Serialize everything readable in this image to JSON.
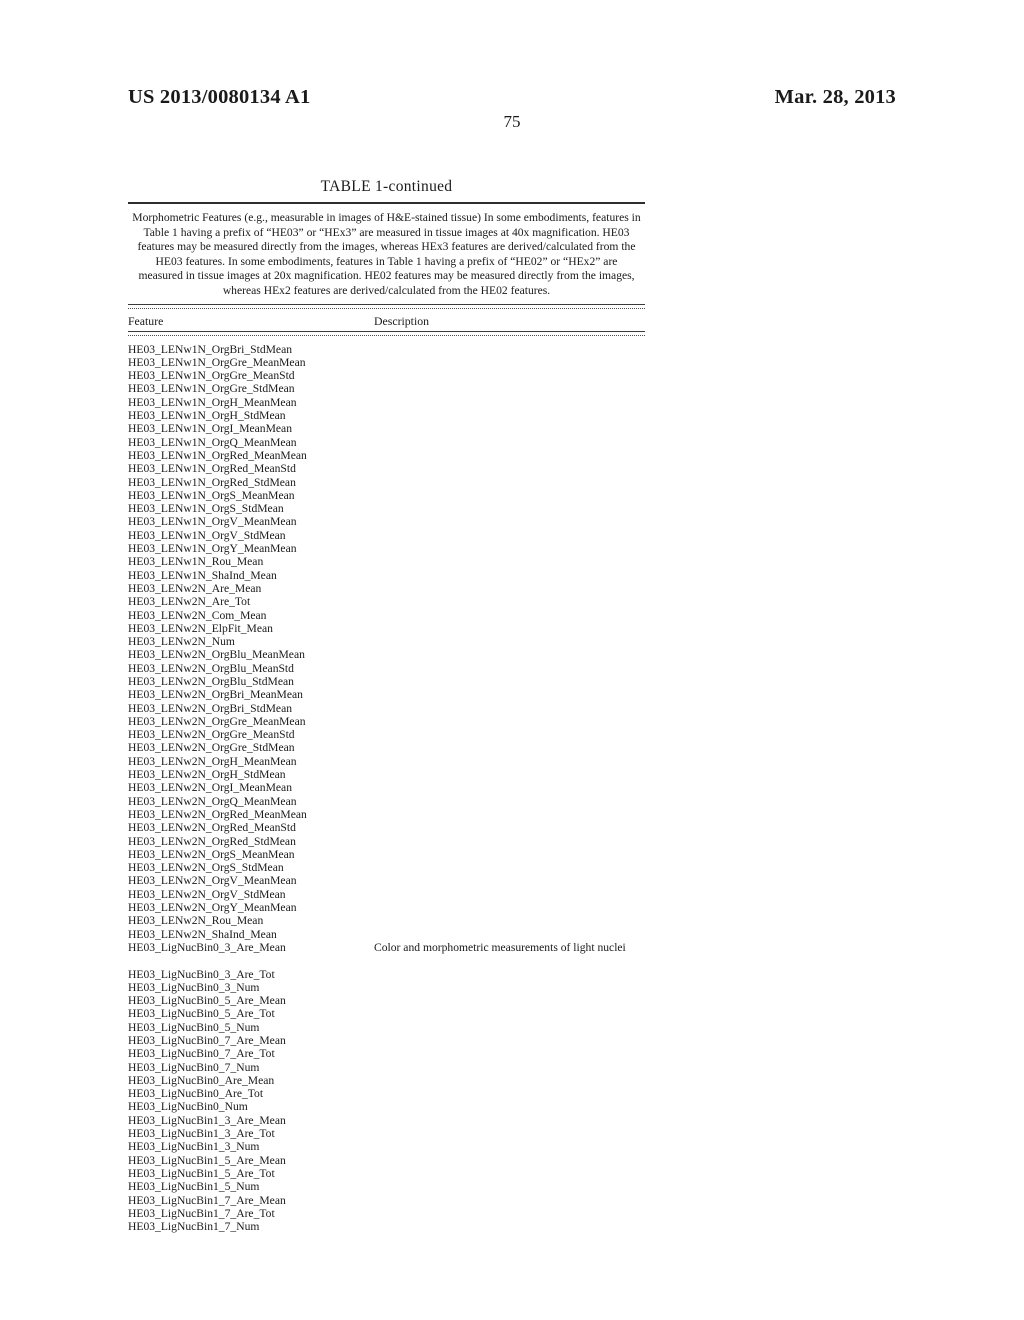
{
  "header": {
    "publication_number": "US 2013/0080134 A1",
    "publication_date": "Mar. 28, 2013",
    "page_number": "75"
  },
  "table": {
    "title": "TABLE 1-continued",
    "caption": "Morphometric Features (e.g., measurable in images of H&E-stained tissue) In some embodiments, features in Table 1 having a prefix of “HE03” or “HEx3” are measured in tissue images at 40x magnification. HE03 features may be measured directly from the images, whereas HEx3 features are derived/calculated from the HE03 features. In some embodiments, features in Table 1 having a prefix of “HE02” or “HEx2” are measured in tissue images at 20x magnification. HE02 features may be measured directly from the images, whereas HEx2 features are derived/calculated from the HE02 features.",
    "columns": {
      "feature": "Feature",
      "description": "Description"
    },
    "rows": [
      {
        "feature": "HE03_LENw1N_OrgBri_StdMean",
        "description": ""
      },
      {
        "feature": "HE03_LENw1N_OrgGre_MeanMean",
        "description": ""
      },
      {
        "feature": "HE03_LENw1N_OrgGre_MeanStd",
        "description": ""
      },
      {
        "feature": "HE03_LENw1N_OrgGre_StdMean",
        "description": ""
      },
      {
        "feature": "HE03_LENw1N_OrgH_MeanMean",
        "description": ""
      },
      {
        "feature": "HE03_LENw1N_OrgH_StdMean",
        "description": ""
      },
      {
        "feature": "HE03_LENw1N_OrgI_MeanMean",
        "description": ""
      },
      {
        "feature": "HE03_LENw1N_OrgQ_MeanMean",
        "description": ""
      },
      {
        "feature": "HE03_LENw1N_OrgRed_MeanMean",
        "description": ""
      },
      {
        "feature": "HE03_LENw1N_OrgRed_MeanStd",
        "description": ""
      },
      {
        "feature": "HE03_LENw1N_OrgRed_StdMean",
        "description": ""
      },
      {
        "feature": "HE03_LENw1N_OrgS_MeanMean",
        "description": ""
      },
      {
        "feature": "HE03_LENw1N_OrgS_StdMean",
        "description": ""
      },
      {
        "feature": "HE03_LENw1N_OrgV_MeanMean",
        "description": ""
      },
      {
        "feature": "HE03_LENw1N_OrgV_StdMean",
        "description": ""
      },
      {
        "feature": "HE03_LENw1N_OrgY_MeanMean",
        "description": ""
      },
      {
        "feature": "HE03_LENw1N_Rou_Mean",
        "description": ""
      },
      {
        "feature": "HE03_LENw1N_ShaInd_Mean",
        "description": ""
      },
      {
        "feature": "HE03_LENw2N_Are_Mean",
        "description": ""
      },
      {
        "feature": "HE03_LENw2N_Are_Tot",
        "description": ""
      },
      {
        "feature": "HE03_LENw2N_Com_Mean",
        "description": ""
      },
      {
        "feature": "HE03_LENw2N_ElpFit_Mean",
        "description": ""
      },
      {
        "feature": "HE03_LENw2N_Num",
        "description": ""
      },
      {
        "feature": "HE03_LENw2N_OrgBlu_MeanMean",
        "description": ""
      },
      {
        "feature": "HE03_LENw2N_OrgBlu_MeanStd",
        "description": ""
      },
      {
        "feature": "HE03_LENw2N_OrgBlu_StdMean",
        "description": ""
      },
      {
        "feature": "HE03_LENw2N_OrgBri_MeanMean",
        "description": ""
      },
      {
        "feature": "HE03_LENw2N_OrgBri_StdMean",
        "description": ""
      },
      {
        "feature": "HE03_LENw2N_OrgGre_MeanMean",
        "description": ""
      },
      {
        "feature": "HE03_LENw2N_OrgGre_MeanStd",
        "description": ""
      },
      {
        "feature": "HE03_LENw2N_OrgGre_StdMean",
        "description": ""
      },
      {
        "feature": "HE03_LENw2N_OrgH_MeanMean",
        "description": ""
      },
      {
        "feature": "HE03_LENw2N_OrgH_StdMean",
        "description": ""
      },
      {
        "feature": "HE03_LENw2N_OrgI_MeanMean",
        "description": ""
      },
      {
        "feature": "HE03_LENw2N_OrgQ_MeanMean",
        "description": ""
      },
      {
        "feature": "HE03_LENw2N_OrgRed_MeanMean",
        "description": ""
      },
      {
        "feature": "HE03_LENw2N_OrgRed_MeanStd",
        "description": ""
      },
      {
        "feature": "HE03_LENw2N_OrgRed_StdMean",
        "description": ""
      },
      {
        "feature": "HE03_LENw2N_OrgS_MeanMean",
        "description": ""
      },
      {
        "feature": "HE03_LENw2N_OrgS_StdMean",
        "description": ""
      },
      {
        "feature": "HE03_LENw2N_OrgV_MeanMean",
        "description": ""
      },
      {
        "feature": "HE03_LENw2N_OrgV_StdMean",
        "description": ""
      },
      {
        "feature": "HE03_LENw2N_OrgY_MeanMean",
        "description": ""
      },
      {
        "feature": "HE03_LENw2N_Rou_Mean",
        "description": ""
      },
      {
        "feature": "HE03_LENw2N_ShaInd_Mean",
        "description": ""
      },
      {
        "feature": "HE03_LigNucBin0_3_Are_Mean",
        "description": "Color and morphometric measurements of light nuclei"
      },
      {
        "feature": "",
        "description": "",
        "spacer": true
      },
      {
        "feature": "HE03_LigNucBin0_3_Are_Tot",
        "description": ""
      },
      {
        "feature": "HE03_LigNucBin0_3_Num",
        "description": ""
      },
      {
        "feature": "HE03_LigNucBin0_5_Are_Mean",
        "description": ""
      },
      {
        "feature": "HE03_LigNucBin0_5_Are_Tot",
        "description": ""
      },
      {
        "feature": "HE03_LigNucBin0_5_Num",
        "description": ""
      },
      {
        "feature": "HE03_LigNucBin0_7_Are_Mean",
        "description": ""
      },
      {
        "feature": "HE03_LigNucBin0_7_Are_Tot",
        "description": ""
      },
      {
        "feature": "HE03_LigNucBin0_7_Num",
        "description": ""
      },
      {
        "feature": "HE03_LigNucBin0_Are_Mean",
        "description": ""
      },
      {
        "feature": "HE03_LigNucBin0_Are_Tot",
        "description": ""
      },
      {
        "feature": "HE03_LigNucBin0_Num",
        "description": ""
      },
      {
        "feature": "HE03_LigNucBin1_3_Are_Mean",
        "description": ""
      },
      {
        "feature": "HE03_LigNucBin1_3_Are_Tot",
        "description": ""
      },
      {
        "feature": "HE03_LigNucBin1_3_Num",
        "description": ""
      },
      {
        "feature": "HE03_LigNucBin1_5_Are_Mean",
        "description": ""
      },
      {
        "feature": "HE03_LigNucBin1_5_Are_Tot",
        "description": ""
      },
      {
        "feature": "HE03_LigNucBin1_5_Num",
        "description": ""
      },
      {
        "feature": "HE03_LigNucBin1_7_Are_Mean",
        "description": ""
      },
      {
        "feature": "HE03_LigNucBin1_7_Are_Tot",
        "description": ""
      },
      {
        "feature": "HE03_LigNucBin1_7_Num",
        "description": ""
      }
    ]
  }
}
